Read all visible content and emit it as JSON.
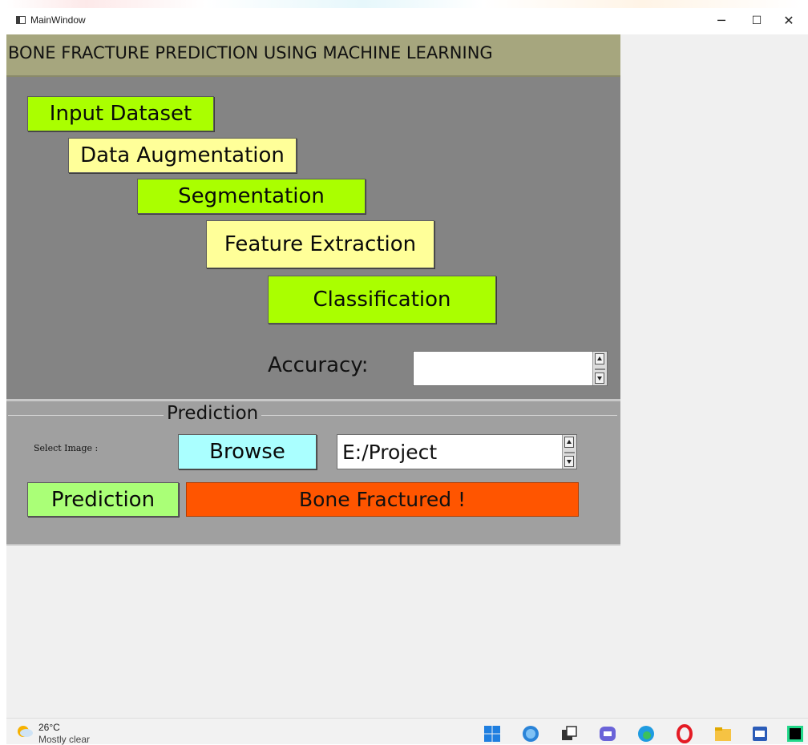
{
  "window": {
    "title": "MainWindow",
    "controls": {
      "minimize": "─",
      "maximize": "☐",
      "close": "✕"
    }
  },
  "app": {
    "banner_title": "BONE FRACTURE PREDICTION USING MACHINE LEARNING",
    "colors": {
      "banner": "#a6a67e",
      "panel": "#848484",
      "prediction_panel": "#a0a0a0",
      "green_button": "#aaff00",
      "yellow_button": "#ffff99",
      "browse_button": "#aaffff",
      "prediction_button": "#aaff77",
      "result": "#ff5500"
    }
  },
  "pipeline": {
    "input_dataset": "Input Dataset",
    "data_augmentation": "Data Augmentation",
    "segmentation": "Segmentation",
    "feature_extraction": "Feature Extraction",
    "classification": "Classification",
    "accuracy_label": "Accuracy:",
    "accuracy_value": ""
  },
  "prediction": {
    "group_title": "Prediction",
    "select_image_label": "Select  Image :",
    "browse_label": "Browse",
    "path_value": "E:/Project",
    "predict_label": "Prediction",
    "result_text": "Bone Fractured !"
  },
  "taskbar": {
    "weather_temp": "26°C",
    "weather_desc": "Mostly clear",
    "icons": [
      "weather-icon",
      "windows-start-icon",
      "search-icon",
      "task-view-icon",
      "chat-icon",
      "edge-icon",
      "opera-icon",
      "file-explorer-icon",
      "word-icon",
      "pycharm-icon"
    ]
  }
}
